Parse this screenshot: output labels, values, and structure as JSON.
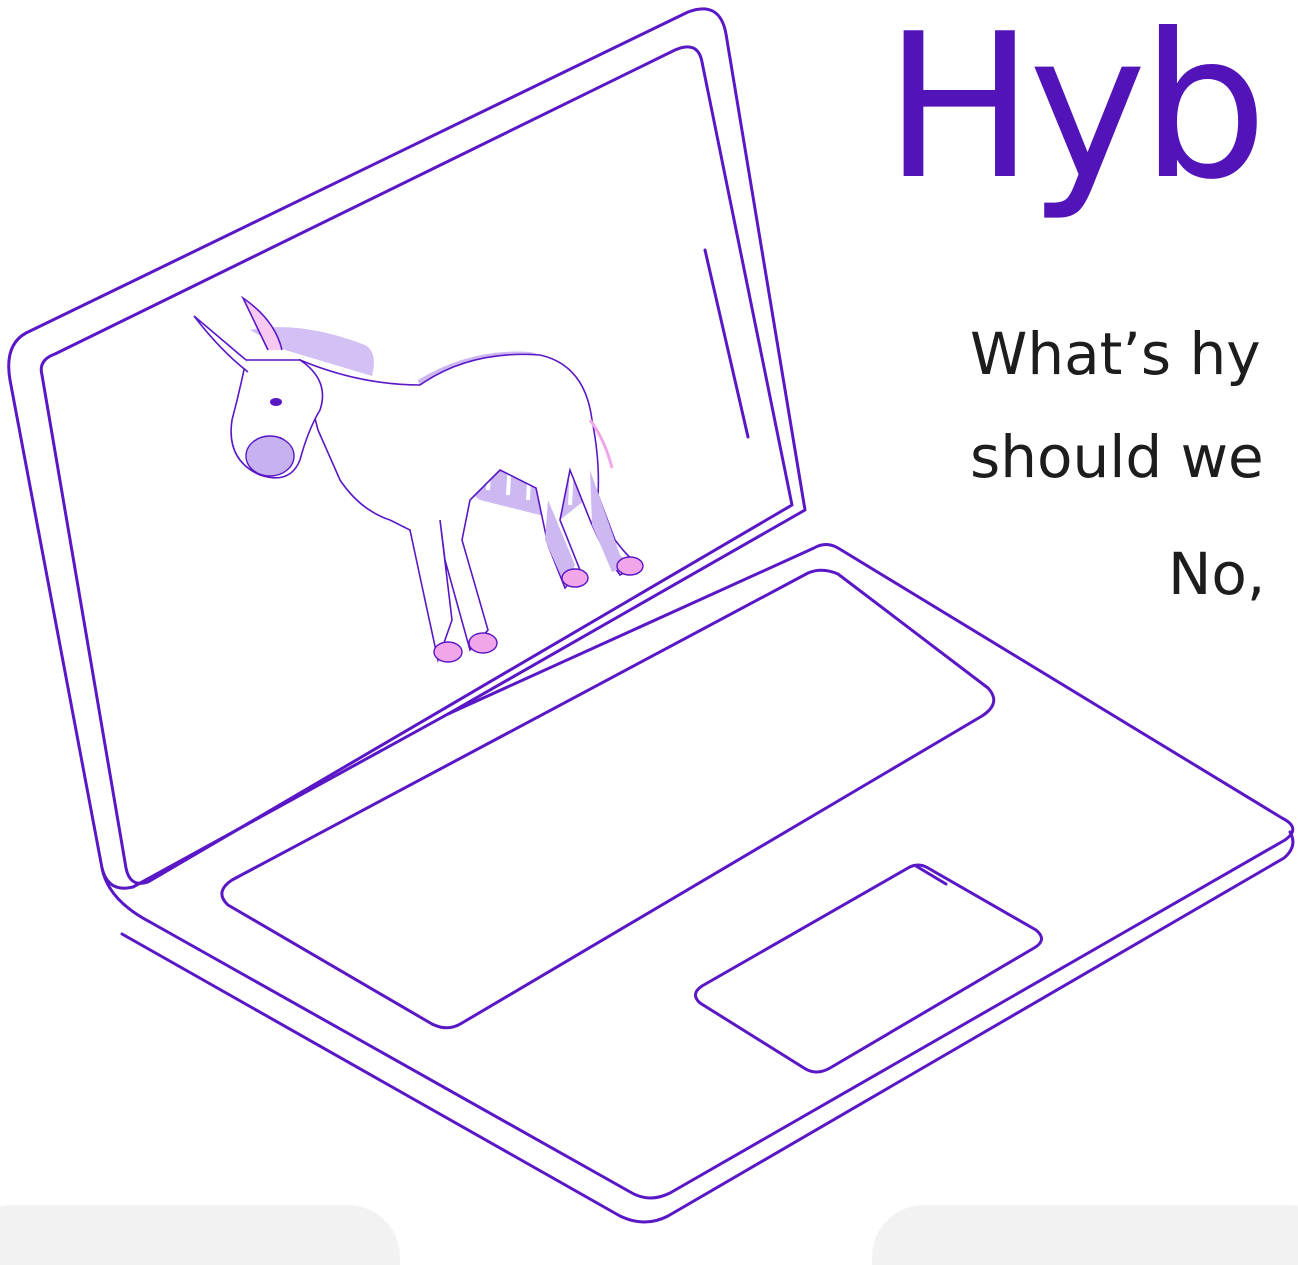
{
  "hero": {
    "title": "Hyb",
    "text_line_1": "What’s hy",
    "text_line_2": "should we",
    "text_line_3": "No,"
  },
  "illustration": {
    "subject": "laptop-with-zebra-donkey-hybrid-on-screen"
  },
  "colors": {
    "brand_purple": "#5214b8",
    "outline_purple": "#5a17c6",
    "lavender": "#cdb8f2",
    "pink_hoof": "#f1a6ea",
    "text_dark": "#1d1d1d",
    "panel_grey": "#f2f2f2"
  }
}
